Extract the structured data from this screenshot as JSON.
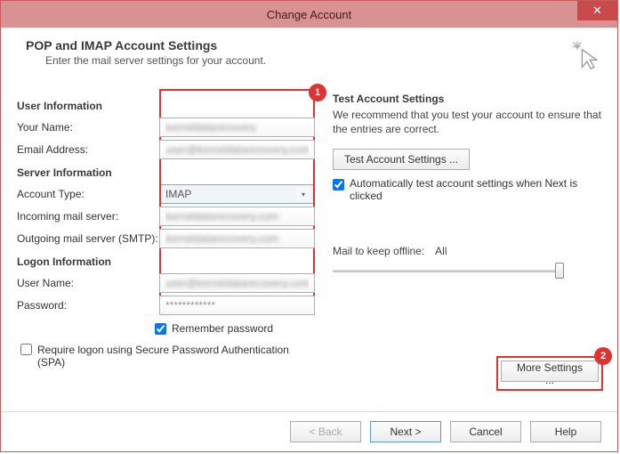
{
  "window": {
    "title": "Change Account"
  },
  "header": {
    "title": "POP and IMAP Account Settings",
    "subtitle": "Enter the mail server settings for your account."
  },
  "sections": {
    "user_info": "User Information",
    "server_info": "Server Information",
    "logon_info": "Logon Information"
  },
  "labels": {
    "your_name": "Your Name:",
    "email": "Email Address:",
    "account_type": "Account Type:",
    "incoming": "Incoming mail server:",
    "outgoing": "Outgoing mail server (SMTP):",
    "user_name": "User Name:",
    "password": "Password:",
    "remember": "Remember password",
    "spa": "Require logon using Secure Password Authentication (SPA)"
  },
  "values": {
    "your_name": "kerneldatarecovery",
    "email": "user@kerneldatarecovery.com",
    "account_type": "IMAP",
    "incoming": "kerneldatarecovery.com",
    "outgoing": "kerneldatarecovery.com",
    "user_name": "user@kerneldatarecovery.com",
    "password": "************",
    "remember_checked": true,
    "spa_checked": false
  },
  "right": {
    "heading": "Test Account Settings",
    "desc": "We recommend that you test your account to ensure that the entries are correct.",
    "test_button": "Test Account Settings ...",
    "auto_test": "Automatically test account settings when Next is clicked",
    "auto_test_checked": true,
    "mail_keep_label": "Mail to keep offline:",
    "mail_keep_value": "All",
    "more_settings": "More Settings ..."
  },
  "badges": {
    "one": "1",
    "two": "2"
  },
  "footer": {
    "back": "< Back",
    "next": "Next >",
    "cancel": "Cancel",
    "help": "Help"
  }
}
